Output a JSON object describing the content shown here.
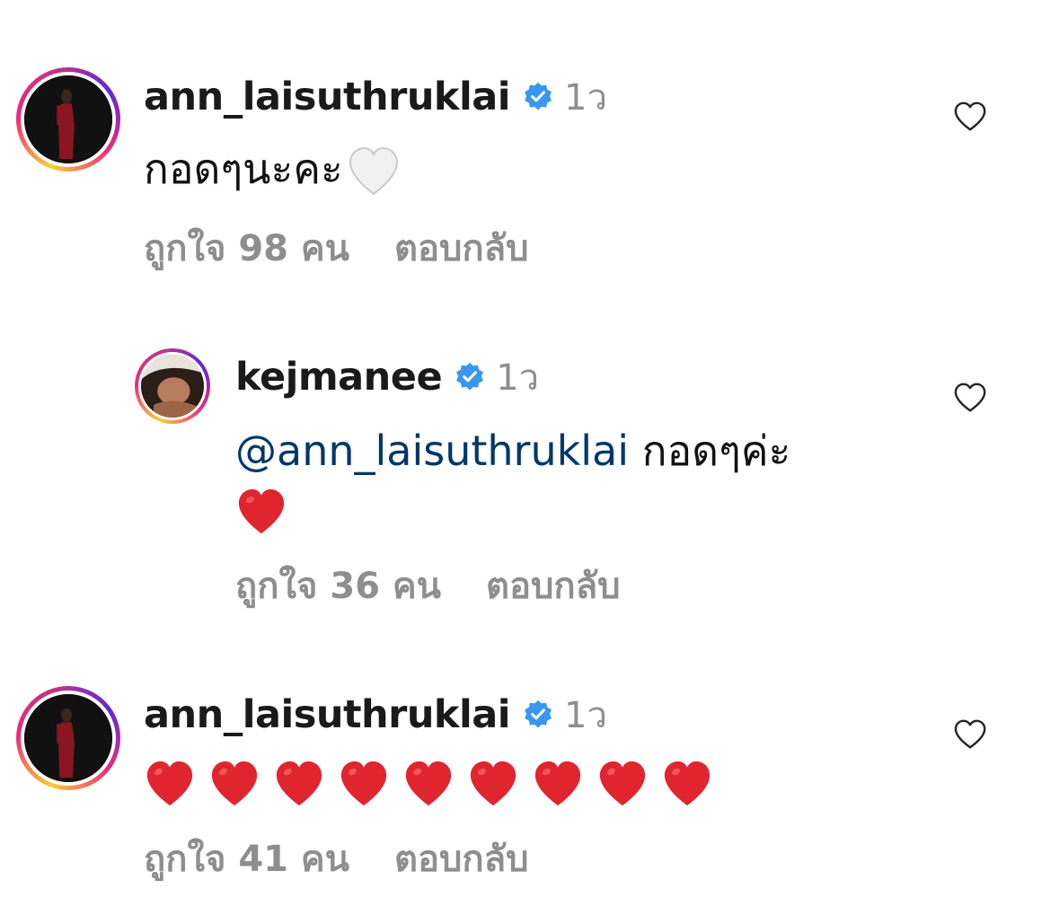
{
  "comments": [
    {
      "username": "ann_laisuthruklai",
      "time": "1ว",
      "text": "กอดๆนะคะ",
      "emoji_name": "white-heart",
      "likes": "ถูกใจ 98 คน",
      "reply": "ตอบกลับ"
    },
    {
      "username": "kejmanee",
      "time": "1ว",
      "mention": "@ann_laisuthruklai",
      "text": " กอดๆค่ะ",
      "emoji_name": "red-heart",
      "likes": "ถูกใจ 36 คน",
      "reply": "ตอบกลับ"
    },
    {
      "username": "ann_laisuthruklai",
      "time": "1ว",
      "emoji_name": "red-heart",
      "emoji_count": 9,
      "likes": "ถูกใจ 41 คน",
      "reply": "ตอบกลับ"
    }
  ],
  "colors": {
    "verified": "#3897f0",
    "mention": "#00376b",
    "meta": "#8e8e8e",
    "heart_red": "#e0252f"
  }
}
